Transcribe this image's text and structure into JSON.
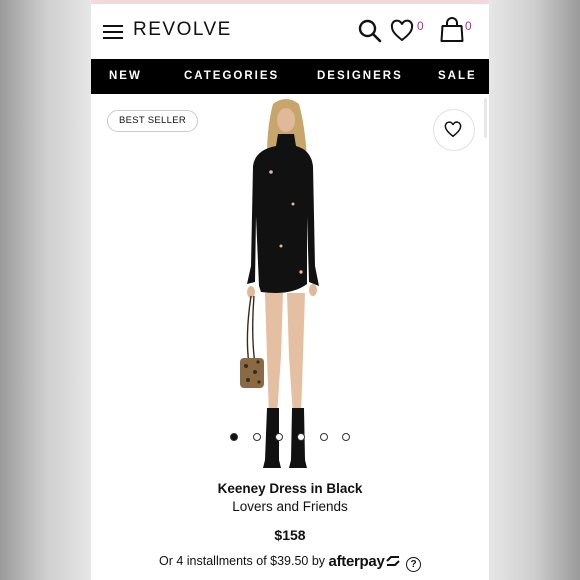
{
  "header": {
    "brand": "REVOLVE",
    "wishlist_count": "0",
    "bag_count": "0"
  },
  "nav": {
    "items": [
      {
        "label": "NEW"
      },
      {
        "label": "CATEGORIES"
      },
      {
        "label": "DESIGNERS"
      },
      {
        "label": "SALE"
      }
    ]
  },
  "product": {
    "badge": "BEST SELLER",
    "name": "Keeney Dress in Black",
    "designer": "Lovers and Friends",
    "price": "$158",
    "installments_text": "Or 4 installments of $39.50 by",
    "afterpay_label": "afterpay",
    "help_label": "?"
  },
  "carousel": {
    "total": 6,
    "active_index": 0
  },
  "colors": {
    "accent": "#b3338c",
    "nav_bg": "#000000"
  },
  "icons": [
    "menu-icon",
    "search-icon",
    "heart-icon",
    "bag-icon",
    "afterpay-arrows-icon",
    "help-icon"
  ]
}
